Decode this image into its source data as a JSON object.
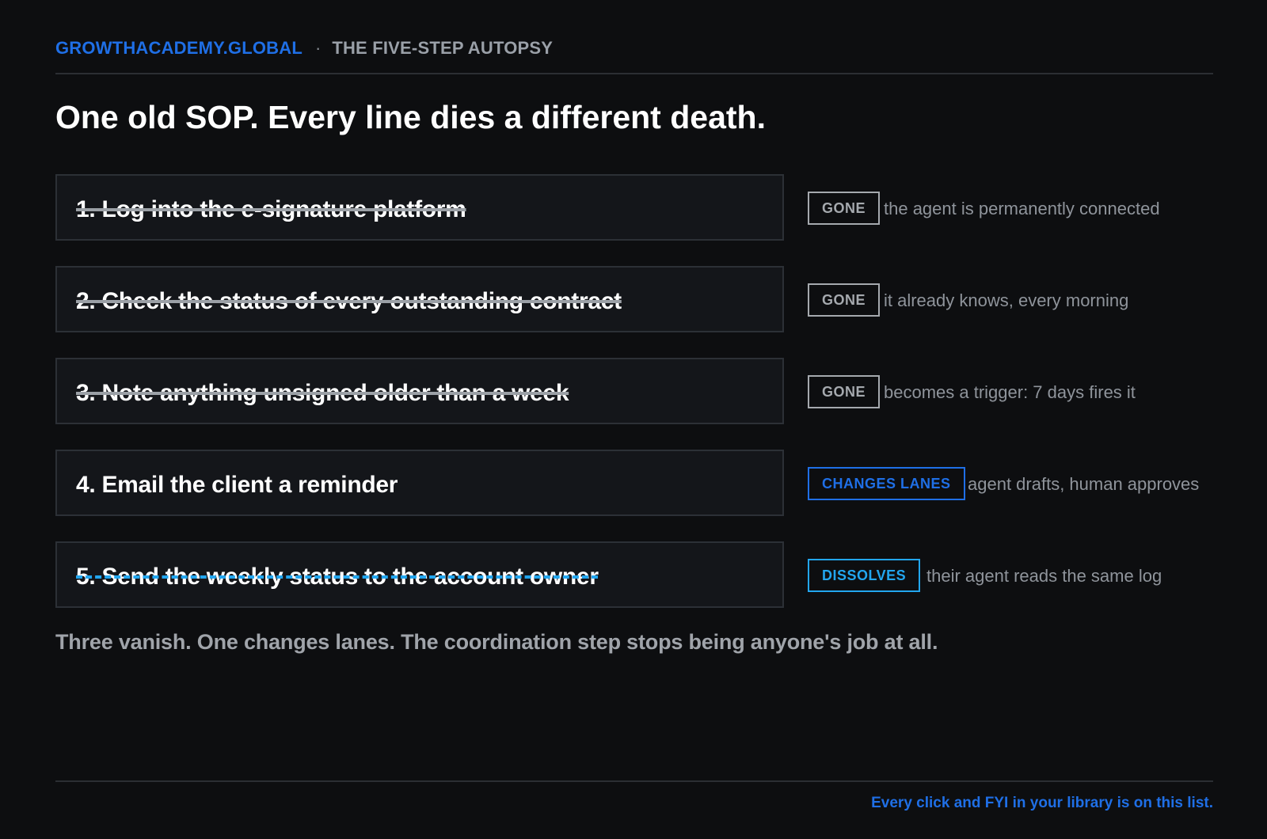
{
  "header": {
    "brand": "GROWTHACADEMY.GLOBAL",
    "separator": "·",
    "subtitle": "THE FIVE-STEP AUTOPSY"
  },
  "title": "One old SOP. Every line dies a different death.",
  "steps": [
    {
      "text": "1. Log into the e-signature platform",
      "status": "GONE",
      "status_kind": "gone",
      "note": "the agent is permanently connected"
    },
    {
      "text": "2. Check the status of every outstanding contract",
      "status": "GONE",
      "status_kind": "gone",
      "note": "it already knows, every morning"
    },
    {
      "text": "3. Note anything unsigned older than a week",
      "status": "GONE",
      "status_kind": "gone",
      "note": "becomes a trigger: 7 days fires it"
    },
    {
      "text": "4. Email the client a reminder",
      "status": "CHANGES LANES",
      "status_kind": "changes",
      "note": "agent drafts, human approves"
    },
    {
      "text": "5. Send the weekly status to the account owner",
      "status": "DISSOLVES",
      "status_kind": "dissolves",
      "note": "their agent reads the same log"
    }
  ],
  "summary": "Three vanish. One changes lanes. The coordination step stops being anyone's job at all.",
  "footer": "Every click and FYI in your library is on this list.",
  "colors": {
    "background": "#0d0e10",
    "accent_blue": "#1f6fe6",
    "accent_cyan": "#22a6ef",
    "muted_gray": "#a5a9ae"
  }
}
